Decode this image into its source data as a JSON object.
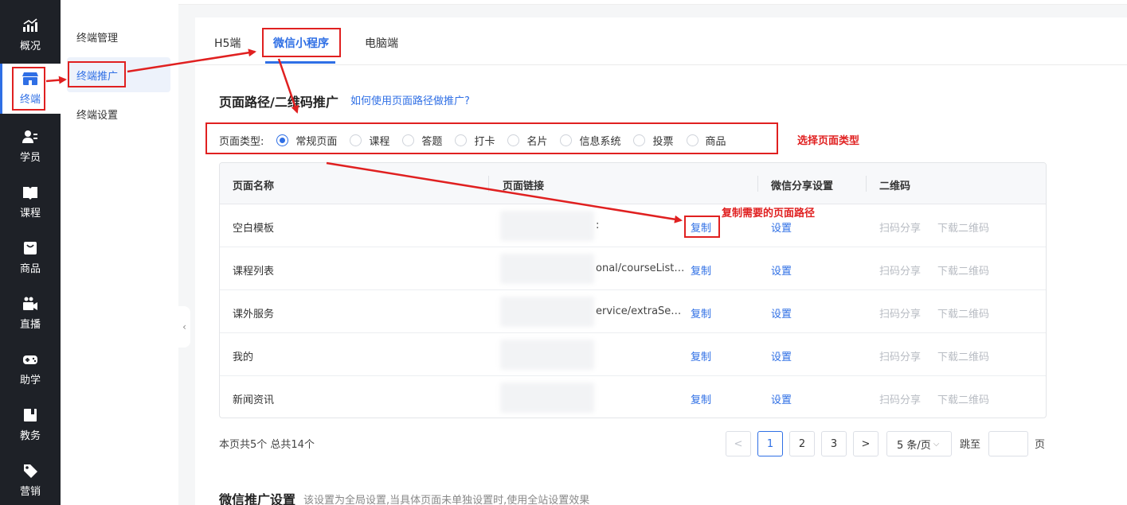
{
  "sidebar": {
    "items": [
      {
        "label": "概况",
        "icon": "chart-trend-icon",
        "active": false
      },
      {
        "label": "终端",
        "icon": "store-icon",
        "active": true
      },
      {
        "label": "学员",
        "icon": "users-icon",
        "active": false
      },
      {
        "label": "课程",
        "icon": "book-icon",
        "active": false
      },
      {
        "label": "商品",
        "icon": "bag-icon",
        "active": false
      },
      {
        "label": "直播",
        "icon": "video-camera-icon",
        "active": false
      },
      {
        "label": "助学",
        "icon": "gamepad-icon",
        "active": false
      },
      {
        "label": "教务",
        "icon": "folder-icon",
        "active": false
      },
      {
        "label": "营销",
        "icon": "tag-icon",
        "active": false
      }
    ]
  },
  "subnav": {
    "items": [
      {
        "label": "终端管理",
        "active": false
      },
      {
        "label": "终端推广",
        "active": true
      },
      {
        "label": "终端设置",
        "active": false
      }
    ]
  },
  "tabs": [
    {
      "label": "H5端",
      "active": false
    },
    {
      "label": "微信小程序",
      "active": true
    },
    {
      "label": "电脑端",
      "active": false
    }
  ],
  "section": {
    "title": "页面路径/二维码推广",
    "help_link": "如何使用页面路径做推广?"
  },
  "page_type": {
    "label": "页面类型:",
    "options": [
      {
        "label": "常规页面",
        "checked": true
      },
      {
        "label": "课程",
        "checked": false
      },
      {
        "label": "答题",
        "checked": false
      },
      {
        "label": "打卡",
        "checked": false
      },
      {
        "label": "名片",
        "checked": false
      },
      {
        "label": "信息系统",
        "checked": false
      },
      {
        "label": "投票",
        "checked": false
      },
      {
        "label": "商品",
        "checked": false
      }
    ]
  },
  "table": {
    "headers": [
      "页面名称",
      "页面链接",
      "微信分享设置",
      "二维码"
    ],
    "rows": [
      {
        "name": "空白模板",
        "link": ":",
        "copy": "复制",
        "setting": "设置",
        "scan": "扫码分享",
        "download": "下载二维码"
      },
      {
        "name": "课程列表",
        "link": "onal/courseList/...",
        "copy": "复制",
        "setting": "设置",
        "scan": "扫码分享",
        "download": "下载二维码"
      },
      {
        "name": "课外服务",
        "link": "ervice/extraServ...",
        "copy": "复制",
        "setting": "设置",
        "scan": "扫码分享",
        "download": "下载二维码"
      },
      {
        "name": "我的",
        "link": "",
        "copy": "复制",
        "setting": "设置",
        "scan": "扫码分享",
        "download": "下载二维码"
      },
      {
        "name": "新闻资讯",
        "link": "",
        "copy": "复制",
        "setting": "设置",
        "scan": "扫码分享",
        "download": "下载二维码"
      }
    ]
  },
  "pagination": {
    "summary": "本页共5个 总共14个",
    "prev": "<",
    "pages": [
      "1",
      "2",
      "3"
    ],
    "current": 1,
    "next": ">",
    "page_size": "5 条/页",
    "jump_label": "跳至",
    "jump_value": "",
    "jump_suffix": "页"
  },
  "wechat_section": {
    "title": "微信推广设置",
    "desc": "该设置为全局设置,当具体页面未单独设置时,使用全站设置效果"
  },
  "annotations": {
    "select_page_type": "选择页面类型",
    "copy_path": "复制需要的页面路径"
  },
  "colors": {
    "primary": "#2f6fe5",
    "sidebar_bg": "#1e2127",
    "annotation": "#e02020"
  }
}
